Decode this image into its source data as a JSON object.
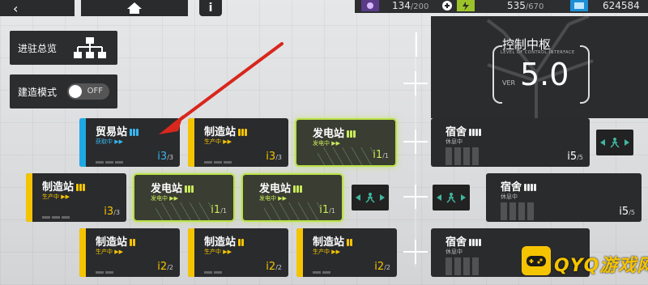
{
  "topbar": {
    "back_icon": "chevron-left-icon",
    "home_icon": "home-icon",
    "info_label": "i",
    "resources": {
      "workforce": "134",
      "workforce_max": "/200",
      "power": "535",
      "power_max": "/670",
      "currency": "624584"
    }
  },
  "sidebar": {
    "overview_label": "进驻总览",
    "buildmode_label": "建造模式",
    "buildmode_toggle": "OFF"
  },
  "control_center": {
    "title": "控制中枢",
    "subtitle": "LEVEL OF CONTROL INTERFACE",
    "ver_label": "VER",
    "version": "5.0"
  },
  "rooms": [
    {
      "id": "trade-1",
      "type": "trade",
      "name": "贸易站",
      "status": "获取中 ▶▶",
      "level": "3",
      "level_max": "/3"
    },
    {
      "id": "mfg-1",
      "type": "mfg",
      "name": "制造站",
      "status": "生产中 ▶▶",
      "level": "3",
      "level_max": "/3"
    },
    {
      "id": "power-1",
      "type": "power",
      "name": "发电站",
      "status": "发电中 ▶▶",
      "level": "1",
      "level_max": "/1"
    },
    {
      "id": "mfg-2",
      "type": "mfg",
      "name": "制造站",
      "status": "生产中 ▶▶",
      "level": "3",
      "level_max": "/3"
    },
    {
      "id": "power-2",
      "type": "power",
      "name": "发电站",
      "status": "发电中 ▶▶",
      "level": "1",
      "level_max": "/1"
    },
    {
      "id": "power-3",
      "type": "power",
      "name": "发电站",
      "status": "发电中 ▶▶",
      "level": "1",
      "level_max": "/1"
    },
    {
      "id": "mfg-3",
      "type": "mfg",
      "name": "制造站",
      "status": "生产中 ▶▶",
      "level": "2",
      "level_max": "/2"
    },
    {
      "id": "mfg-4",
      "type": "mfg",
      "name": "制造站",
      "status": "生产中 ▶▶",
      "level": "2",
      "level_max": "/2"
    },
    {
      "id": "mfg-5",
      "type": "mfg",
      "name": "制造站",
      "status": "生产中 ▶▶",
      "level": "2",
      "level_max": "/2"
    },
    {
      "id": "dorm-1",
      "type": "dorm",
      "name": "宿舍",
      "status": "休息中",
      "level": "5",
      "level_max": "/5"
    },
    {
      "id": "dorm-2",
      "type": "dorm",
      "name": "宿舍",
      "status": "休息中",
      "level": "5",
      "level_max": "/5"
    },
    {
      "id": "dorm-3",
      "type": "dorm",
      "name": "宿舍",
      "status": "休息中",
      "level": "",
      "level_max": ""
    }
  ],
  "watermark": {
    "text": "QYQ游戏网"
  },
  "colors": {
    "manufacture": "#f5c400",
    "trade": "#1fa8e6",
    "power": "#b9e146",
    "panel": "#2a2b2d"
  }
}
